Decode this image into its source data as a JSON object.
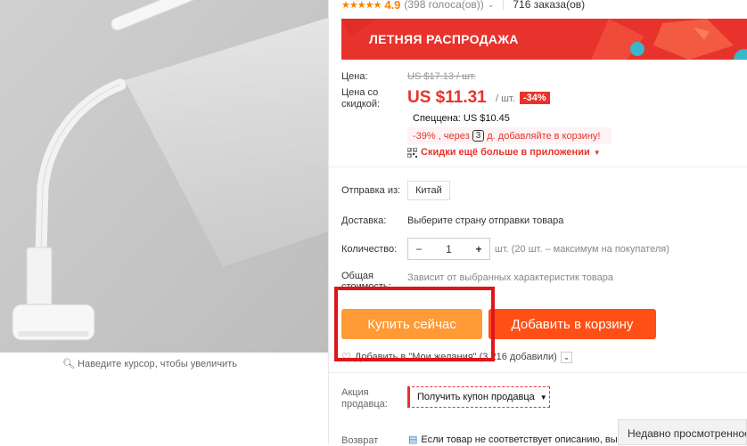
{
  "rating": {
    "score": "4.9",
    "votes": "(398 голоса(ов))",
    "orders": "716 заказа(ов)"
  },
  "banner": {
    "text": "ЛЕТНЯЯ РАСПРОДАЖА"
  },
  "price": {
    "label": "Цена:",
    "original": "US $17.13 / шт.",
    "sale_label": "Цена со скидкой:",
    "sale": "US $11.31",
    "unit": "/ шт.",
    "discount": "-34%",
    "special": "Спеццена: US $10.45",
    "coupon_pct": "-39%",
    "coupon_mid": ", через",
    "coupon_count": "3",
    "coupon_end": "д. добавляйте в корзину!",
    "app_text": "Скидки ещё больше в приложении"
  },
  "shipping": {
    "from_label": "Отправка из:",
    "from_value": "Китай",
    "delivery_label": "Доставка:",
    "delivery_value": "Выберите страну отправки товара"
  },
  "quantity": {
    "label": "Количество:",
    "minus": "−",
    "value": "1",
    "plus": "+",
    "note": "шт. (20 шт. – максимум на покупателя)"
  },
  "total": {
    "label": "Общая стоимость:",
    "value": "Зависит от выбранных характеристик товара"
  },
  "actions": {
    "buy_now": "Купить сейчас",
    "add_cart": "Добавить в корзину"
  },
  "wishlist": {
    "text": "Добавить в \"Мои желания\" (3 216 добавили)"
  },
  "promo": {
    "label": "Акция продавца:",
    "button": "Получить купон продавца"
  },
  "returns": {
    "label": "Возврат",
    "text": "Если товар не соответствует описанию, вы"
  },
  "recent": {
    "label": "Недавно просмотренное"
  },
  "image": {
    "zoom_hint": "Наведите курсор, чтобы увеличить"
  },
  "colors": {
    "accent": "#e8322c",
    "buy_now": "#ff9a34",
    "add_cart": "#ff4f16",
    "star": "#ff7e00"
  }
}
